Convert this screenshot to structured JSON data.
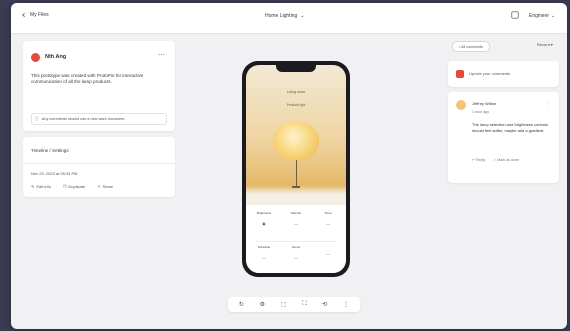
{
  "topbar": {
    "back_label": "My Files",
    "doc_title": "Home Lighting",
    "user_label": "Engineer"
  },
  "workspace_card": {
    "name": "Nth Ang",
    "description": "This prototype was created with ProtoPie for interactive communication of all the lamp products.",
    "note": "Any comments should use a new work document."
  },
  "version_card": {
    "label": "Timeline / Settings",
    "meta": "Nov 29, 2023 at 05:34 PM",
    "actions": [
      "Edit info",
      "Duplicate",
      "Share"
    ]
  },
  "phone": {
    "title": "Living room",
    "subtitle": "Pendant light",
    "controls": [
      {
        "label": "Brightness",
        "value": "▣"
      },
      {
        "label": "Warmth",
        "value": "—"
      },
      {
        "label": "Timer",
        "value": "—"
      },
      {
        "label": "Schedule",
        "value": "—"
      },
      {
        "label": "Scene",
        "value": "—"
      },
      {
        "label": "",
        "value": "—"
      }
    ]
  },
  "toolbar": {
    "icons": [
      "refresh-icon",
      "gear-icon",
      "crop-icon",
      "fullscreen-icon",
      "rotate-icon",
      "more-icon"
    ]
  },
  "right_panel": {
    "tag_label": "• All comments",
    "filter_label": "Recent ▾",
    "likes_text": "Upvote your comments",
    "comment": {
      "author": "Jeffrey Wilton",
      "time": "1 hour ago",
      "body": "The lamp selection and brightness controls should feel softer, maybe add a gradient.",
      "actions": [
        "↩ Reply",
        "✓ Mark as done"
      ]
    }
  },
  "colors": {
    "accent": "#e24a3e",
    "background": "#3a3d52",
    "canvas": "#f1f1f3"
  }
}
